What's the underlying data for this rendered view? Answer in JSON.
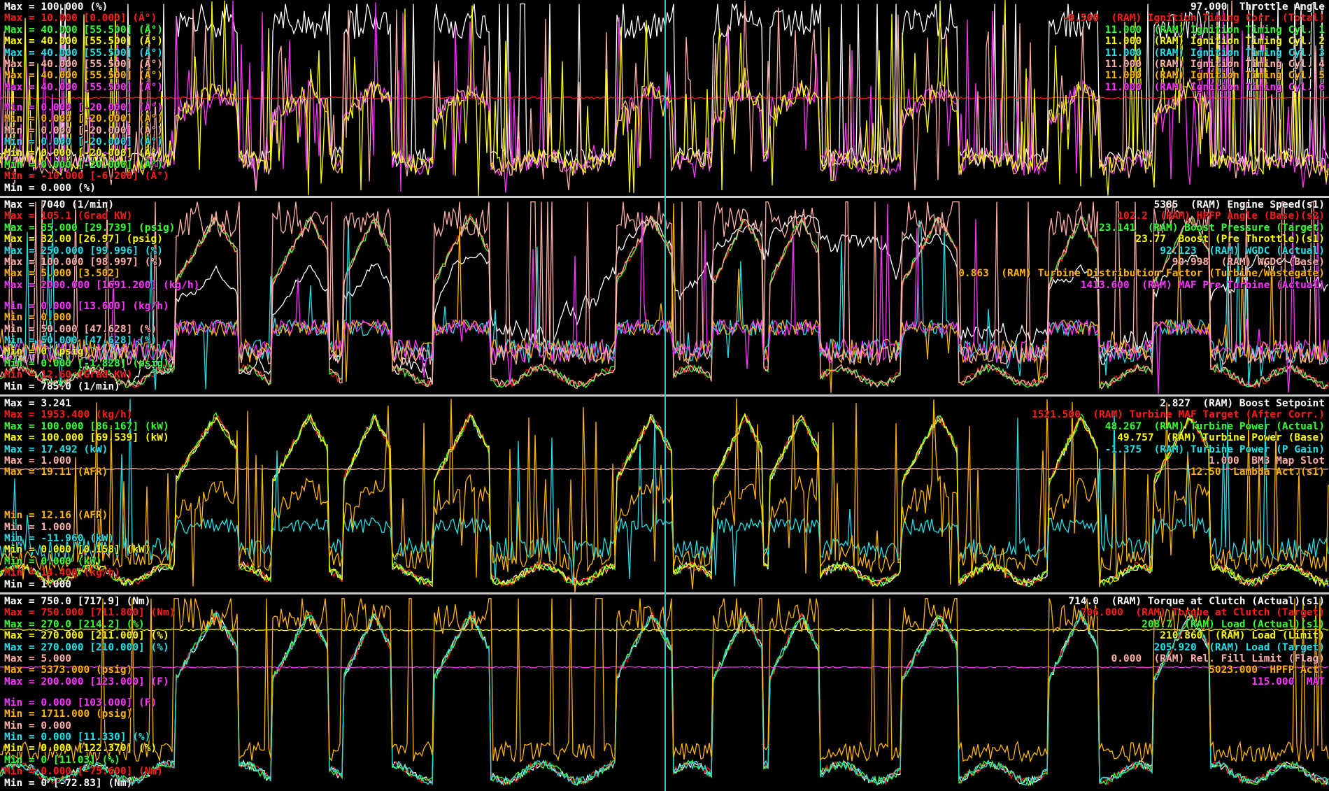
{
  "colors": {
    "white": "#ffffff",
    "red": "#ff1a1a",
    "green": "#33ff33",
    "yellow": "#ffff00",
    "cyan": "#22e0e8",
    "pink": "#ffb0a8",
    "orange": "#ffb400",
    "magenta": "#ff33ff",
    "cursor": "#2fc7d6",
    "separator": "#c8c8c8"
  },
  "panels": [
    {
      "id": "ignition",
      "max_labels": [
        {
          "text": "Max = 100.000 (%)",
          "color": "white"
        },
        {
          "text": "Max = 10.000 [0.000] (Â°)",
          "color": "red"
        },
        {
          "text": "Max = 40.000 [55.500] (Â°)",
          "color": "green"
        },
        {
          "text": "Max = 40.000 [55.500] (Â°)",
          "color": "yellow"
        },
        {
          "text": "Max = 40.000 [55.500] (Â°)",
          "color": "cyan"
        },
        {
          "text": "Max = 40.000 [55.500] (Â°)",
          "color": "pink"
        },
        {
          "text": "Max = 40.000 [55.500] (Â°)",
          "color": "orange"
        },
        {
          "text": "Max = 40.000 [55.500] (Â°)",
          "color": "magenta"
        }
      ],
      "min_labels": [
        {
          "text": "Min = 0.000 [-20.000] (Â°)",
          "color": "magenta"
        },
        {
          "text": "Min = 0.000 [-20.000] (Â°)",
          "color": "orange"
        },
        {
          "text": "Min = 0.000 [-20.000] (Â°)",
          "color": "pink"
        },
        {
          "text": "Min = 0.000 [-20.000] (Â°)",
          "color": "cyan"
        },
        {
          "text": "Min = 0.000 [-20.000] (Â°)",
          "color": "yellow"
        },
        {
          "text": "Min = 0.000 [-20.000] (Â°)",
          "color": "green"
        },
        {
          "text": "Min = -10.000 [-6.200] (Â°)",
          "color": "red"
        },
        {
          "text": "Min = 0.000 (%)",
          "color": "white"
        }
      ],
      "channels": [
        {
          "text": "97.000  Throttle Angle",
          "color": "white"
        },
        {
          "text": "-0.500  (RAM) Ignition Timing Corr. (Total)",
          "color": "red"
        },
        {
          "text": "11.000  (RAM) Ignition Timing Cyl. 1",
          "color": "green"
        },
        {
          "text": "11.000  (RAM) Ignition Timing Cyl. 2",
          "color": "yellow"
        },
        {
          "text": "11.000  (RAM) Ignition Timing Cyl. 3",
          "color": "cyan"
        },
        {
          "text": "11.000  (RAM) Ignition Timing Cyl. 4",
          "color": "pink"
        },
        {
          "text": "11.000  (RAM) Ignition Timing Cyl. 5",
          "color": "orange"
        },
        {
          "text": "11.000  (RAM) Ignition Timing Cyl. 6",
          "color": "magenta"
        }
      ]
    },
    {
      "id": "boost",
      "max_labels": [
        {
          "text": "Max = 7040 (1/min)",
          "color": "white"
        },
        {
          "text": "Max = 105.1 (Grad KW)",
          "color": "red"
        },
        {
          "text": "Max = 35.000 [29.739] (psig)",
          "color": "green"
        },
        {
          "text": "Max = 32.00 [26.97] (psig)",
          "color": "yellow"
        },
        {
          "text": "Max = 250.000 [99.996] (%)",
          "color": "cyan"
        },
        {
          "text": "Max = 100.000 [98.997] (%)",
          "color": "pink"
        },
        {
          "text": "Max = 5.000 [3.502]",
          "color": "orange"
        },
        {
          "text": "Max = 2000.000 [1691.200] (kg/h)",
          "color": "magenta"
        }
      ],
      "min_labels": [
        {
          "text": "Min = 0.000 [13.600] (kg/h)",
          "color": "magenta"
        },
        {
          "text": "Min = 0.000",
          "color": "orange"
        },
        {
          "text": "Min = 50.000 [47.628] (%)",
          "color": "pink"
        },
        {
          "text": "Min = 50.000 [47.628] (%)",
          "color": "cyan"
        },
        {
          "text": "Min = 0 (psig)",
          "color": "yellow"
        },
        {
          "text": "Min = 0.000 [-1.828] (psig)",
          "color": "green"
        },
        {
          "text": "Min = 12.60 (Grad KW)",
          "color": "red"
        },
        {
          "text": "Min = 785.0 (1/min)",
          "color": "white"
        }
      ],
      "channels": [
        {
          "text": "5385  (RAM) Engine Speed(s1)",
          "color": "white"
        },
        {
          "text": "102.2  (RAM) HPFP Angle (Base)(s2)",
          "color": "red"
        },
        {
          "text": "23.141  (RAM) Boost Pressure (Target)",
          "color": "green"
        },
        {
          "text": "23.77  Boost (Pre Throttle)(s1)",
          "color": "yellow"
        },
        {
          "text": "92.123  (RAM) WGDC (Actual)",
          "color": "cyan"
        },
        {
          "text": "90.998  (RAM) WGDC (Base)",
          "color": "pink"
        },
        {
          "text": "0.863  (RAM) Turbine Distribution Factor (Turbine/Wastegate)",
          "color": "orange"
        },
        {
          "text": "1413.600  (RAM) MAF Pre Turbine (Actual)",
          "color": "magenta"
        }
      ]
    },
    {
      "id": "turbine",
      "max_labels": [
        {
          "text": "Max = 3.241",
          "color": "white"
        },
        {
          "text": "Max = 1953.400 (kg/h)",
          "color": "red"
        },
        {
          "text": "Max = 100.000 [86.167] (kW)",
          "color": "green"
        },
        {
          "text": "Max = 100.000 [69.539] (kW)",
          "color": "yellow"
        },
        {
          "text": "Max = 17.492 (kW)",
          "color": "cyan"
        },
        {
          "text": "Max = 1.000",
          "color": "pink"
        },
        {
          "text": "Max = 19.11 (AFR)",
          "color": "orange"
        }
      ],
      "min_labels": [
        {
          "text": "Min = 12.16 (AFR)",
          "color": "orange"
        },
        {
          "text": "Min = 1.000",
          "color": "pink"
        },
        {
          "text": "Min = -11.960 (kW)",
          "color": "cyan"
        },
        {
          "text": "Min = 0.000 [0.158] (kW)",
          "color": "yellow"
        },
        {
          "text": "Min = 0.000 (kW)",
          "color": "green"
        },
        {
          "text": "Min = 14.400 (kg/h)",
          "color": "red"
        },
        {
          "text": "Min = 1.000",
          "color": "white"
        }
      ],
      "channels": [
        {
          "text": "2.827  (RAM) Boost Setpoint",
          "color": "white"
        },
        {
          "text": "1521.500  (RAM) Turbine MAF Target (After Corr.)",
          "color": "red"
        },
        {
          "text": "48.267  (RAM) Turbine Power (Actual)",
          "color": "green"
        },
        {
          "text": "49.757  (RAM) Turbine Power (Base)",
          "color": "yellow"
        },
        {
          "text": "-1.375  (RAM) Turbine Power (P Gain)",
          "color": "cyan"
        },
        {
          "text": "1.000  BM3 Map Slot",
          "color": "pink"
        },
        {
          "text": "12.50  Lambda Act.(s1)",
          "color": "orange"
        }
      ]
    },
    {
      "id": "torque",
      "max_labels": [
        {
          "text": "Max = 750.0 [717.9] (Nm)",
          "color": "white"
        },
        {
          "text": "Max = 750.000 [711.800] (Nm)",
          "color": "red"
        },
        {
          "text": "Max = 270.0 [214.2] (%)",
          "color": "green"
        },
        {
          "text": "Max = 270.000 [211.000] (%)",
          "color": "yellow"
        },
        {
          "text": "Max = 270.000 [210.000] (%)",
          "color": "cyan"
        },
        {
          "text": "Max = 5.000",
          "color": "pink"
        },
        {
          "text": "Max = 5373.000 (psig)",
          "color": "orange"
        },
        {
          "text": "Max = 200.000 [123.000] (F)",
          "color": "magenta"
        }
      ],
      "min_labels": [
        {
          "text": "Min = 0.000 [103.000] (F)",
          "color": "magenta"
        },
        {
          "text": "Min = 1711.000 (psig)",
          "color": "orange"
        },
        {
          "text": "Min = 0.000",
          "color": "pink"
        },
        {
          "text": "Min = 0.000 [11.330] (%)",
          "color": "cyan"
        },
        {
          "text": "Min = 0.000 [122.370] (%)",
          "color": "yellow"
        },
        {
          "text": "Min = 0 [11.03] (%)",
          "color": "green"
        },
        {
          "text": "Min = 0.000 [-75.600] (Nm)",
          "color": "red"
        },
        {
          "text": "Min = 0 [-72.83] (Nm)",
          "color": "white"
        }
      ],
      "channels": [
        {
          "text": "714.0  (RAM) Torque at Clutch (Actual)(s1)",
          "color": "white"
        },
        {
          "text": "706.000  (RAM) Torque at Clutch (Target)",
          "color": "red"
        },
        {
          "text": "208.7  (RAM) Load (Actual)(s1)",
          "color": "green"
        },
        {
          "text": "210.860  (RAM) Load (Limit)",
          "color": "yellow"
        },
        {
          "text": "205.920  (RAM) Load (Target)",
          "color": "cyan"
        },
        {
          "text": "0.000  (RAM) Rel. Fill Limit (Flag)",
          "color": "pink"
        },
        {
          "text": "5023.000  HPFP Act.",
          "color": "orange"
        },
        {
          "text": "115.000  MAT",
          "color": "magenta"
        }
      ]
    }
  ]
}
